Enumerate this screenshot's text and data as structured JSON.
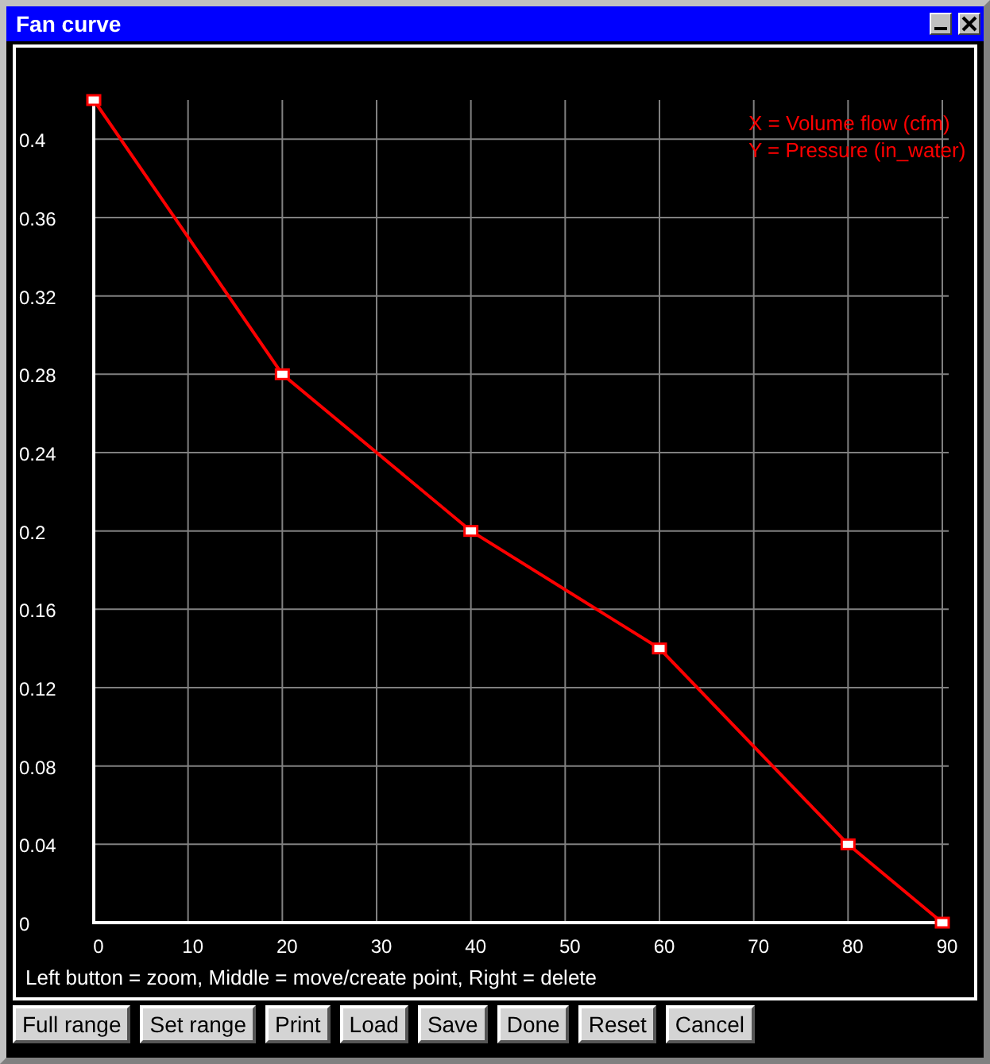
{
  "window": {
    "title": "Fan curve",
    "controls": [
      {
        "kind": "minimize"
      },
      {
        "kind": "close"
      }
    ]
  },
  "chart": {
    "chart_data": {
      "type": "line",
      "x": [
        0,
        20,
        40,
        60,
        80,
        90
      ],
      "series": [
        {
          "color": "#ff0000",
          "marker": "square",
          "values": [
            0.42,
            0.28,
            0.2,
            0.14,
            0.04,
            0
          ]
        }
      ],
      "grid": true,
      "xlim": [
        0,
        90
      ],
      "ylim": [
        0,
        0.42
      ],
      "xticks": [
        0,
        10,
        20,
        30,
        40,
        50,
        60,
        70,
        80,
        90
      ],
      "yticks": [
        0,
        0.04,
        0.08,
        0.12,
        0.16,
        0.2,
        0.24,
        0.28,
        0.32,
        0.36,
        0.4
      ],
      "annotations": [
        "X = Volume flow (cfm)",
        "Y = Pressure (in_water)"
      ]
    }
  },
  "help_text": "Left button = zoom, Middle = move/create point, Right = delete",
  "buttons": [
    "Full range",
    "Set range",
    "Print",
    "Load",
    "Save",
    "Done",
    "Reset",
    "Cancel"
  ]
}
